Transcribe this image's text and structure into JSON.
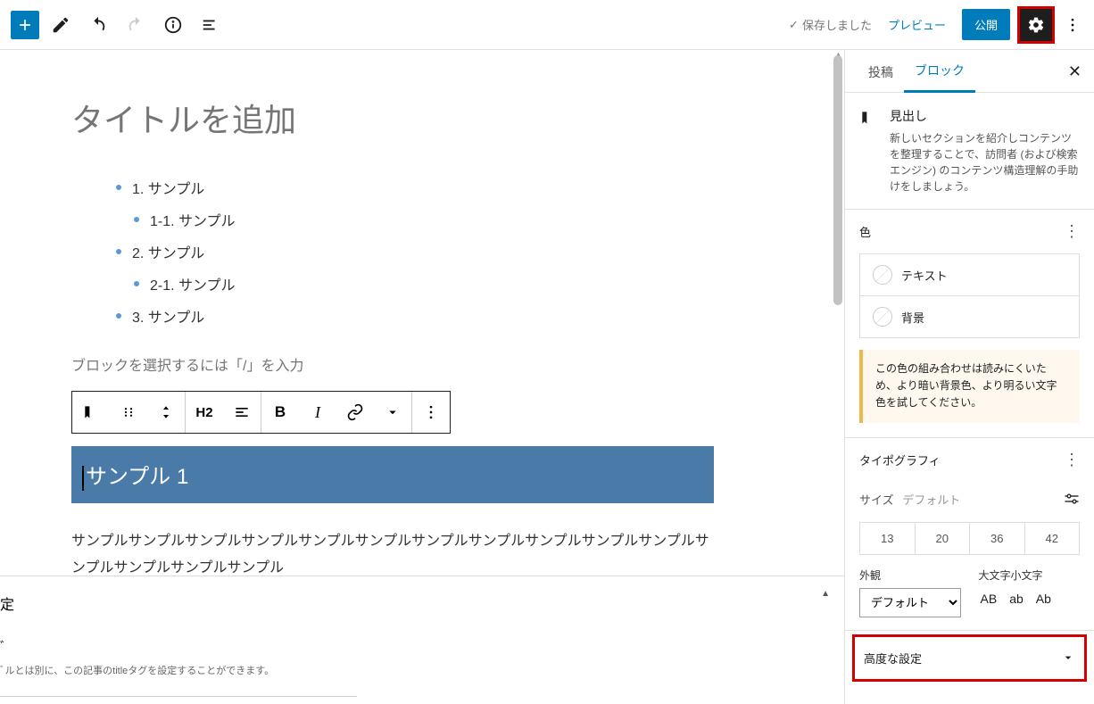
{
  "toolbar": {
    "saved_label": "保存しました",
    "preview_label": "プレビュー",
    "publish_label": "公開"
  },
  "editor": {
    "title_placeholder": "タイトルを追加",
    "toc": [
      {
        "text": "1.  サンプル",
        "sub": false
      },
      {
        "text": "1-1.  サンプル",
        "sub": true
      },
      {
        "text": "2.  サンプル",
        "sub": false
      },
      {
        "text": "2-1.  サンプル",
        "sub": true
      },
      {
        "text": "3.  サンプル",
        "sub": false
      }
    ],
    "block_hint": "ブロックを選択するには「/」を入力",
    "heading_level": "H2",
    "heading_text": "サンプル 1",
    "paragraph": "サンプルサンプルサンプルサンプルサンプルサンプルサンプルサンプルサンプルサンプルサンプルサンプルサンプルサンプルサンプル"
  },
  "meta": {
    "section_title": "定",
    "sub_title": "ﾞ",
    "desc": "ﾞルとは別に、この記事のtitleタグを設定することができます。"
  },
  "sidebar": {
    "tabs": {
      "post": "投稿",
      "block": "ブロック"
    },
    "block_info": {
      "title": "見出し",
      "desc": "新しいセクションを紹介しコンテンツを整理することで、訪問者 (および検索エンジン) のコンテンツ構造理解の手助けをしましょう。"
    },
    "color": {
      "heading": "色",
      "text_label": "テキスト",
      "bg_label": "背景",
      "warning": "この色の組み合わせは読みにくいため、より暗い背景色、より明るい文字色を試してください。"
    },
    "typography": {
      "heading": "タイポグラフィ",
      "size_label": "サイズ",
      "size_default": "デフォルト",
      "sizes": [
        "13",
        "20",
        "36",
        "42"
      ],
      "appearance_label": "外観",
      "appearance_default": "デフォルト",
      "case_label": "大文字小文字",
      "cases": [
        "AB",
        "ab",
        "Ab"
      ]
    },
    "advanced": {
      "heading": "高度な設定"
    }
  }
}
